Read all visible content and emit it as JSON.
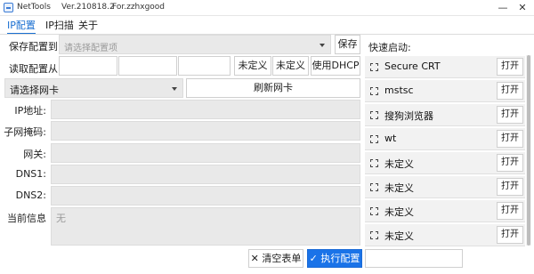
{
  "window": {
    "app_name": "NetTools",
    "version": "Ver.210818.2",
    "author": "For.zzhxgood",
    "min_glyph": "—",
    "close_glyph": "✕"
  },
  "tabs": [
    {
      "label": "IP配置",
      "active": true
    },
    {
      "label": "IP扫描",
      "active": false
    },
    {
      "label": "关于",
      "active": false
    }
  ],
  "save_config": {
    "label": "保存配置到:",
    "placeholder": "请选择配置项",
    "button": "保存"
  },
  "read_config": {
    "label": "读取配置从:",
    "btn_undefined_1": "未定义",
    "btn_undefined_2": "未定义",
    "btn_dhcp": "使用DHCP"
  },
  "adapter": {
    "placeholder": "请选择网卡",
    "refresh": "刷新网卡"
  },
  "fields": {
    "ip": "IP地址:",
    "mask": "子网掩码:",
    "gateway": "网关:",
    "dns1": "DNS1:",
    "dns2": "DNS2:",
    "info_label": "当前信息",
    "info_value": "无"
  },
  "quick_launch": {
    "title": "快速启动:",
    "items": [
      {
        "name": "Secure CRT",
        "open": "打开"
      },
      {
        "name": "mstsc",
        "open": "打开"
      },
      {
        "name": "搜狗浏览器",
        "open": "打开"
      },
      {
        "name": "wt",
        "open": "打开"
      },
      {
        "name": "未定义",
        "open": "打开"
      },
      {
        "name": "未定义",
        "open": "打开"
      },
      {
        "name": "未定义",
        "open": "打开"
      },
      {
        "name": "未定义",
        "open": "打开"
      }
    ]
  },
  "footer": {
    "clear": "清空表单",
    "clear_glyph": "✕",
    "run": "执行配置",
    "run_glyph": "✓"
  },
  "accent_color": "#1a73e8"
}
